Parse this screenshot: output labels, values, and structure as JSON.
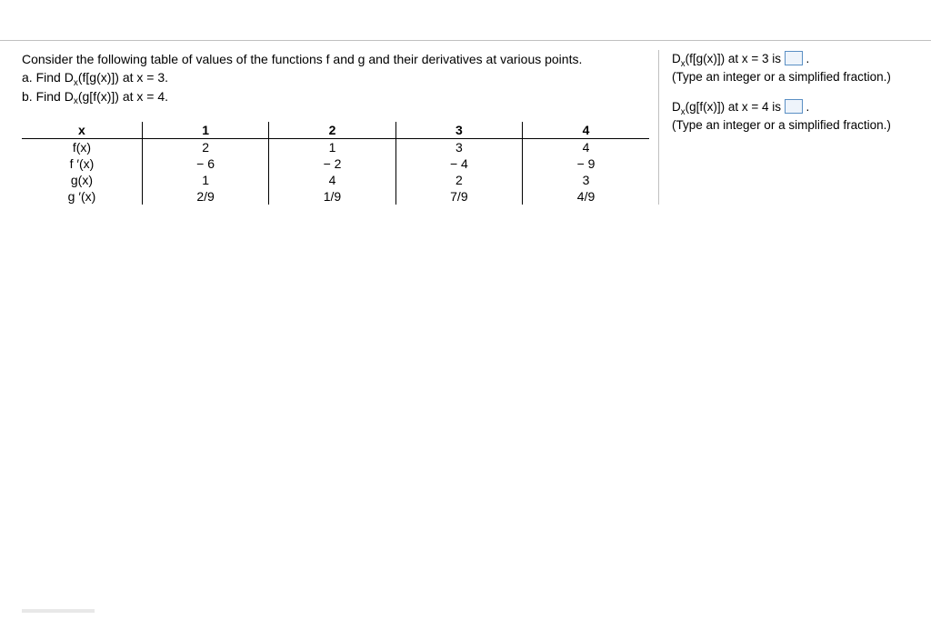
{
  "problem": {
    "intro": "Consider the following table of values of the functions f and g and their derivatives at various points.",
    "part_a": "a. Find D",
    "part_a_sub": "x",
    "part_a_rest": "(f[g(x)]) at x = 3.",
    "part_b": "b. Find D",
    "part_b_sub": "x",
    "part_b_rest": "(g[f(x)]) at x = 4."
  },
  "table": {
    "headers": [
      "x",
      "1",
      "2",
      "3",
      "4"
    ],
    "rows": [
      {
        "label": "f(x)",
        "cells": [
          "2",
          "1",
          "3",
          "4"
        ]
      },
      {
        "label": "f ′(x)",
        "cells": [
          "− 6",
          "− 2",
          "− 4",
          "− 9"
        ]
      },
      {
        "label": "g(x)",
        "cells": [
          "1",
          "4",
          "2",
          "3"
        ]
      },
      {
        "label": "g ′(x)",
        "cells": [
          "2/9",
          "1/9",
          "7/9",
          "4/9"
        ]
      }
    ]
  },
  "answers": {
    "a_prefix": "D",
    "a_sub": "x",
    "a_mid": "(f[g(x)]) at x = 3 is ",
    "a_suffix": ".",
    "a_hint": "(Type an integer or a simplified fraction.)",
    "b_prefix": "D",
    "b_sub": "x",
    "b_mid": "(g[f(x)]) at x = 4 is ",
    "b_suffix": ".",
    "b_hint": "(Type an integer or a simplified fraction.)"
  }
}
